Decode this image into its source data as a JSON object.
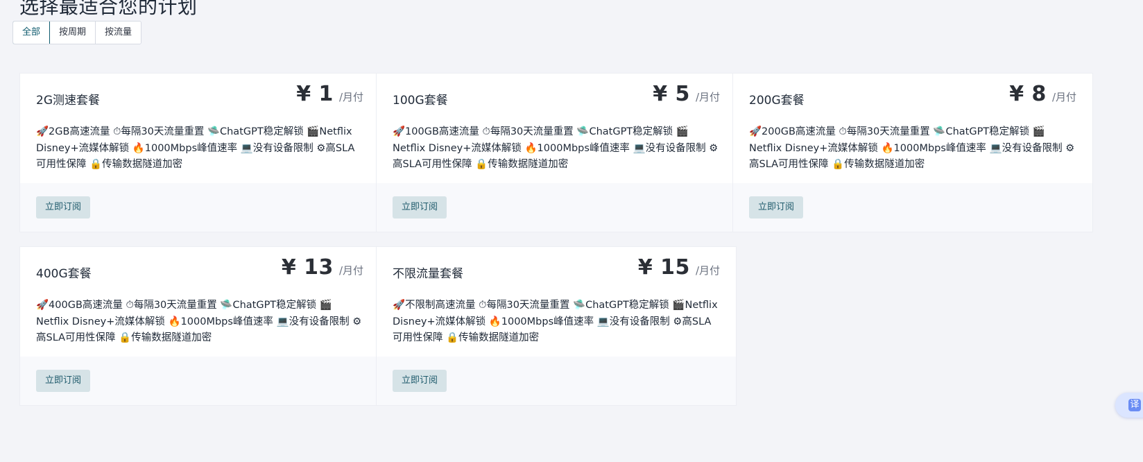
{
  "page_title": "选择最适合您的计划",
  "tabs": [
    {
      "label": "全部",
      "active": true
    },
    {
      "label": "按周期",
      "active": false
    },
    {
      "label": "按流量",
      "active": false
    }
  ],
  "plans": [
    {
      "name": "2G测速套餐",
      "price": "¥ 1",
      "period": "/月付",
      "features": "🚀2GB高速流量 ⏱每隔30天流量重置 🛸ChatGPT稳定解锁 🎬Netflix Disney+流媒体解锁 🔥1000Mbps峰值速率 💻没有设备限制 ⚙高SLA可用性保障 🔒传输数据隧道加密",
      "button": "立即订阅"
    },
    {
      "name": "100G套餐",
      "price": "¥ 5",
      "period": "/月付",
      "features": "🚀100GB高速流量 ⏱每隔30天流量重置 🛸ChatGPT稳定解锁 🎬Netflix Disney+流媒体解锁 🔥1000Mbps峰值速率 💻没有设备限制 ⚙高SLA可用性保障 🔒传输数据隧道加密",
      "button": "立即订阅"
    },
    {
      "name": "200G套餐",
      "price": "¥ 8",
      "period": "/月付",
      "features": "🚀200GB高速流量 ⏱每隔30天流量重置 🛸ChatGPT稳定解锁 🎬Netflix Disney+流媒体解锁 🔥1000Mbps峰值速率 💻没有设备限制 ⚙高SLA可用性保障 🔒传输数据隧道加密",
      "button": "立即订阅"
    },
    {
      "name": "400G套餐",
      "price": "¥ 13",
      "period": "/月付",
      "features": "🚀400GB高速流量 ⏱每隔30天流量重置 🛸ChatGPT稳定解锁 🎬Netflix Disney+流媒体解锁 🔥1000Mbps峰值速率 💻没有设备限制 ⚙高SLA可用性保障 🔒传输数据隧道加密",
      "button": "立即订阅"
    },
    {
      "name": "不限流量套餐",
      "price": "¥ 15",
      "period": "/月付",
      "features": "🚀不限制高速流量 ⏱每隔30天流量重置 🛸ChatGPT稳定解锁 🎬Netflix Disney+流媒体解锁 🔥1000Mbps峰值速率 💻没有设备限制 ⚙高SLA可用性保障 🔒传输数据隧道加密",
      "button": "立即订阅"
    }
  ],
  "translate_button": "译",
  "colors": {
    "accent": "#0f5b6e",
    "button_bg": "#d6e3e7",
    "page_bg": "#f3f4f8"
  }
}
